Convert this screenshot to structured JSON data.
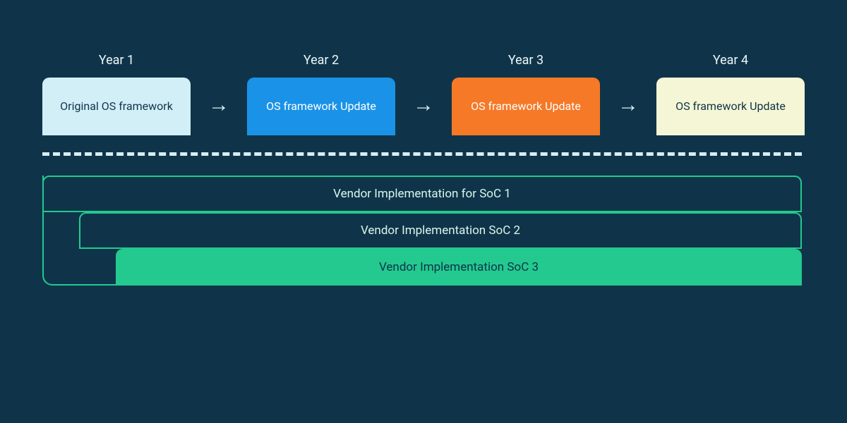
{
  "years": [
    {
      "label": "Year 1",
      "box": "Original OS framework",
      "style": "box-a"
    },
    {
      "label": "Year 2",
      "box": "OS framework Update",
      "style": "box-b"
    },
    {
      "label": "Year 3",
      "box": "OS framework Update",
      "style": "box-c"
    },
    {
      "label": "Year 4",
      "box": "OS framework Update",
      "style": "box-d"
    }
  ],
  "arrow_glyph": "→",
  "vendors": {
    "soc1": "Vendor Implementation for SoC 1",
    "soc2": "Vendor Implementation SoC 2",
    "soc3": "Vendor Implementation SoC 3"
  },
  "colors": {
    "background": "#0f3449",
    "accent_green": "#23c98f",
    "light_blue": "#d2eff8",
    "blue": "#1a92e8",
    "orange": "#f57927",
    "cream": "#f5f6d6",
    "dash": "#d7eef5"
  }
}
